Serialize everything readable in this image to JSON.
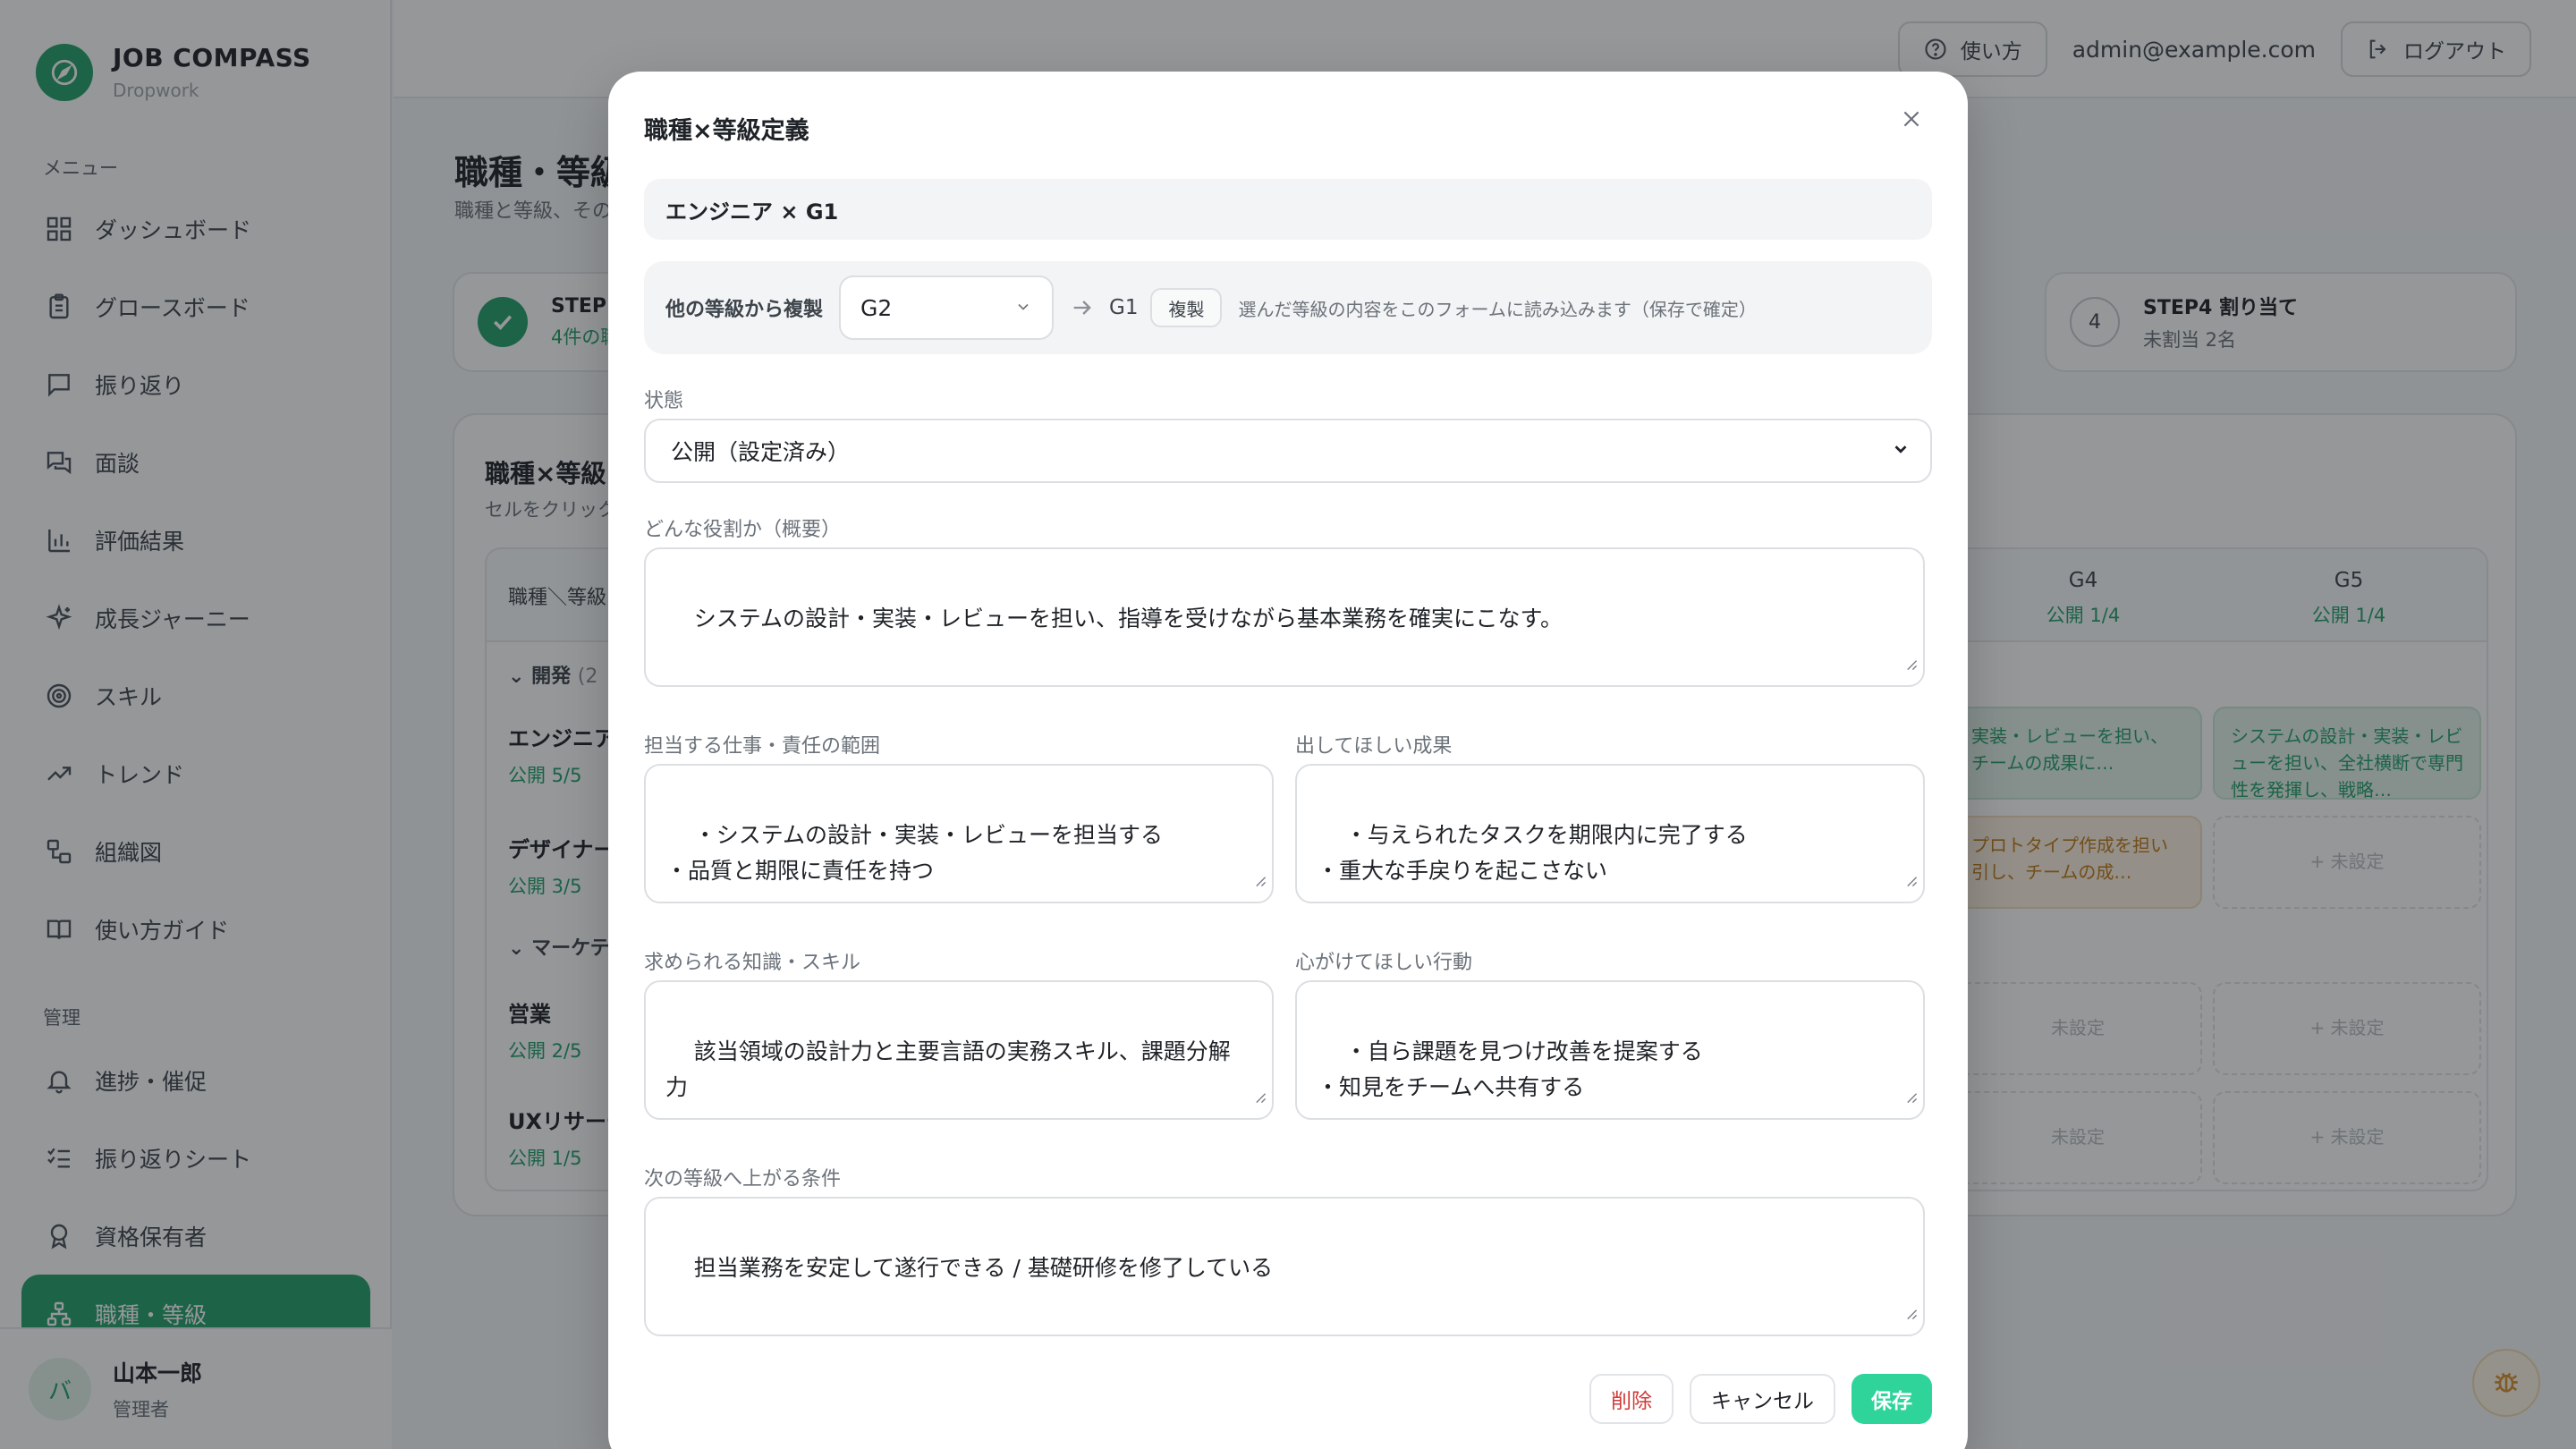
{
  "brand": {
    "title": "JOB COMPASS",
    "subtitle": "Dropwork"
  },
  "sidebar": {
    "menu_label": "メニュー",
    "admin_label": "管理",
    "menu_items": [
      {
        "label": "ダッシュボード",
        "icon": "dashboard-icon"
      },
      {
        "label": "グロースボード",
        "icon": "clipboard-icon"
      },
      {
        "label": "振り返り",
        "icon": "chat-icon"
      },
      {
        "label": "面談",
        "icon": "conversation-icon"
      },
      {
        "label": "評価結果",
        "icon": "bar-chart-icon"
      },
      {
        "label": "成長ジャーニー",
        "icon": "sparkle-icon"
      },
      {
        "label": "スキル",
        "icon": "target-icon"
      },
      {
        "label": "トレンド",
        "icon": "trend-up-icon"
      },
      {
        "label": "組織図",
        "icon": "org-chart-icon"
      },
      {
        "label": "使い方ガイド",
        "icon": "book-icon"
      }
    ],
    "admin_items": [
      {
        "label": "進捗・催促",
        "icon": "bell-icon"
      },
      {
        "label": "振り返りシート",
        "icon": "checklist-icon"
      },
      {
        "label": "資格保有者",
        "icon": "badge-icon"
      },
      {
        "label": "職種・等級",
        "icon": "hierarchy-icon",
        "active": true
      }
    ],
    "user": {
      "initial": "バ",
      "name": "山本一郎",
      "role": "管理者"
    }
  },
  "header": {
    "help_label": "使い方",
    "email": "admin@example.com",
    "logout_label": "ログアウト"
  },
  "background": {
    "page_title": "職種・等級",
    "page_desc": "職種と等級、その",
    "steps": [
      {
        "title": "STEP1",
        "sub": "4件の職"
      },
      {
        "num": "4",
        "title": "STEP4 割り当て",
        "sub": "未割当 2名"
      }
    ],
    "matrix_title": "職種×等級",
    "matrix_desc": "セルをクリックし",
    "corner_label": "職種＼等級",
    "grades": [
      {
        "g": "G4",
        "s": "公開 1/4"
      },
      {
        "g": "G5",
        "s": "公開 1/4"
      }
    ],
    "groups": [
      {
        "label": "開発",
        "count": "(2"
      },
      {
        "label": "マーケテ"
      }
    ],
    "rows": [
      {
        "name": "エンジニア",
        "pub": "公開 5/5"
      },
      {
        "name": "デザイナー",
        "pub": "公開 3/5"
      },
      {
        "name": "営業",
        "pub": "公開 2/5"
      },
      {
        "name": "UXリサーチ",
        "pub": "公開 1/5"
      }
    ],
    "cells": {
      "eng_g4": "実装・レビューを担い、チームの成果に…",
      "eng_g5": "システムの設計・実装・レビューを担い、全社横断で専門性を発揮し、戦略…",
      "des_g4": "プロトタイプ作成を担い引し、チームの成…",
      "unset": "+ 未設定",
      "unset_partial": "未設定"
    }
  },
  "modal": {
    "title": "職種×等級定義",
    "target": "エンジニア × G1",
    "copy": {
      "label": "他の等級から複製",
      "selected": "G2",
      "target": "G1",
      "button": "複製",
      "note": "選んだ等級の内容をこのフォームに読み込みます（保存で確定）"
    },
    "status": {
      "label": "状態",
      "value": "公開（設定済み）"
    },
    "summary": {
      "label": "どんな役割か（概要）",
      "value": "システムの設計・実装・レビューを担い、指導を受けながら基本業務を確実にこなす。"
    },
    "scope": {
      "label": "担当する仕事・責任の範囲",
      "value": "・システムの設計・実装・レビューを担当する\n・品質と期限に責任を持つ"
    },
    "results": {
      "label": "出してほしい成果",
      "value": "・与えられたタスクを期限内に完了する\n・重大な手戻りを起こさない"
    },
    "skills": {
      "label": "求められる知識・スキル",
      "value": "該当領域の設計力と主要言語の実務スキル、課題分解力"
    },
    "behavior": {
      "label": "心がけてほしい行動",
      "value": "・自ら課題を見つけ改善を提案する\n・知見をチームへ共有する"
    },
    "promotion": {
      "label": "次の等級へ上がる条件",
      "value": "担当業務を安定して遂行できる / 基礎研修を修了している"
    },
    "buttons": {
      "delete": "削除",
      "cancel": "キャンセル",
      "save": "保存"
    }
  }
}
